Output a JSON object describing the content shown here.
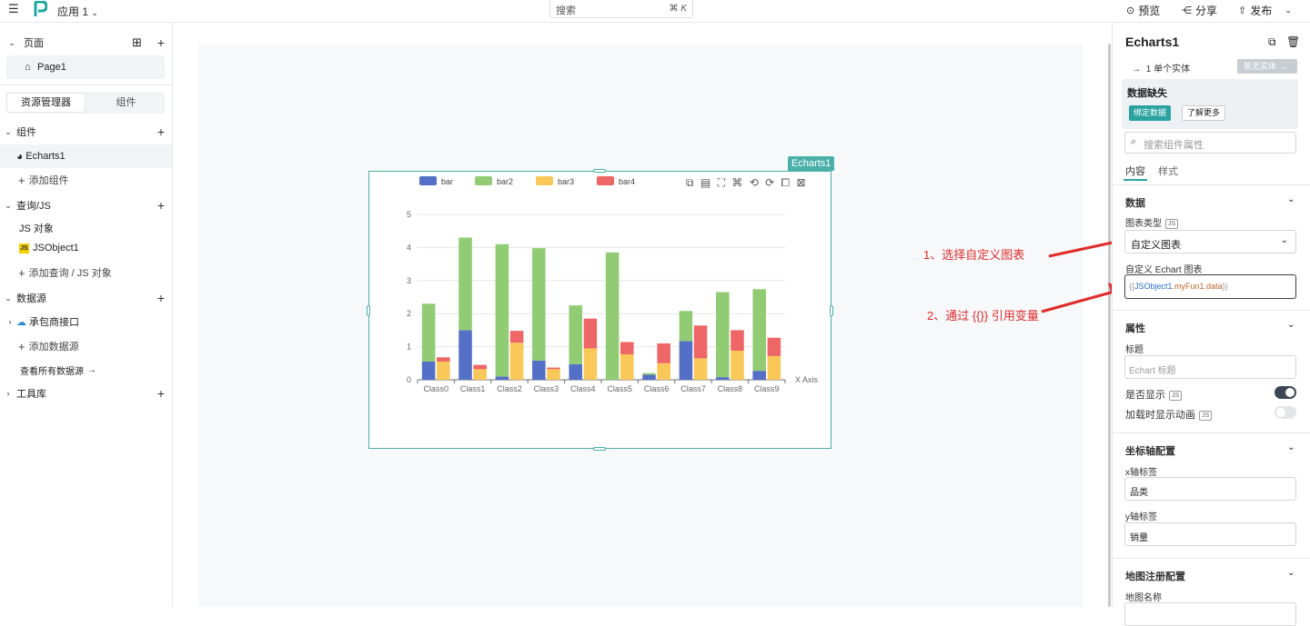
{
  "topbar": {
    "app_name": "应用 1",
    "search_placeholder": "搜索",
    "search_shortcut": "⌘ K",
    "preview_label": "预览",
    "share_label": "分享",
    "publish_label": "发布"
  },
  "sidebar": {
    "pages_label": "页面",
    "page_item": "Page1",
    "tab_resources": "资源管理器",
    "tab_widgets": "组件",
    "widgets_section": "组件",
    "widget_item": "Echarts1",
    "add_widget": "添加组件",
    "queries_section": "查询/JS",
    "js_objects_label": "JS 对象",
    "js_object_item": "JSObject1",
    "add_query": "添加查询 / JS 对象",
    "datasource_section": "数据源",
    "datasource_item": "承包商接口",
    "add_datasource": "添加数据源",
    "view_all_datasources": "查看所有数据源",
    "library_section": "工具库"
  },
  "widget": {
    "tag": "Echarts1"
  },
  "chart_data": {
    "type": "bar",
    "stacked": true,
    "categories": [
      "Class0",
      "Class1",
      "Class2",
      "Class3",
      "Class4",
      "Class5",
      "Class6",
      "Class7",
      "Class8",
      "Class9"
    ],
    "series": [
      {
        "name": "bar",
        "color": "#5470c6",
        "values": [
          0.55,
          1.5,
          0.1,
          0.58,
          0.47,
          0.0,
          0.15,
          1.17,
          0.08,
          0.27
        ]
      },
      {
        "name": "bar2",
        "color": "#91cc75",
        "values": [
          1.75,
          2.8,
          4.0,
          3.4,
          1.78,
          3.85,
          0.05,
          0.91,
          2.57,
          2.47
        ]
      },
      {
        "name": "bar3",
        "color": "#fac858",
        "values": [
          0.55,
          0.32,
          1.12,
          0.32,
          0.95,
          0.77,
          0.5,
          0.65,
          0.88,
          0.72
        ]
      },
      {
        "name": "bar4",
        "color": "#ee6666",
        "values": [
          0.13,
          0.13,
          0.36,
          0.05,
          0.9,
          0.37,
          0.6,
          0.99,
          0.62,
          0.55
        ]
      }
    ],
    "stack_groups": [
      [
        "bar",
        "bar2"
      ],
      [
        "bar3",
        "bar4"
      ]
    ],
    "xlabel": "X Axis",
    "ylabel": "",
    "ylim": [
      0,
      5
    ],
    "yticks": [
      0,
      1,
      2,
      3,
      4,
      5
    ],
    "grid": true,
    "legend": "top-left"
  },
  "annotations": {
    "step1": "1、选择自定义图表",
    "step2": "2、通过 {{}} 引用变量"
  },
  "rightpanel": {
    "title": "Echarts1",
    "entity_count": "1 单个实体",
    "no_entity_button": "暂无实体",
    "missing_data_title": "数据缺失",
    "bind_data_button": "绑定数据",
    "learn_more_button": "了解更多",
    "search_placeholder": "搜索组件属性",
    "tab_content": "内容",
    "tab_style": "样式",
    "data_section": "数据",
    "chart_type_label": "图表类型",
    "chart_type_value": "自定义图表",
    "custom_echart_label": "自定义 Echart 图表",
    "custom_echart_value_prefix": "{{",
    "custom_echart_value_object": "JSObject1",
    "custom_echart_value_func": ".myFun1.data",
    "custom_echart_value_suffix": "}}",
    "props_section": "属性",
    "title_label": "标题",
    "title_placeholder": "Echart 标题",
    "visible_label": "是否显示",
    "animate_label": "加载时显示动画",
    "axis_section": "坐标轴配置",
    "xaxis_label": "x轴标签",
    "xaxis_value": "品类",
    "yaxis_label": "y轴标签",
    "yaxis_value": "销量",
    "map_section": "地图注册配置",
    "map_name_label": "地图名称",
    "js_badge": "JS"
  },
  "colors": {
    "accent": "#4ab0a8",
    "toggle_on": "#3c4654",
    "annotation": "#e02b2b"
  }
}
